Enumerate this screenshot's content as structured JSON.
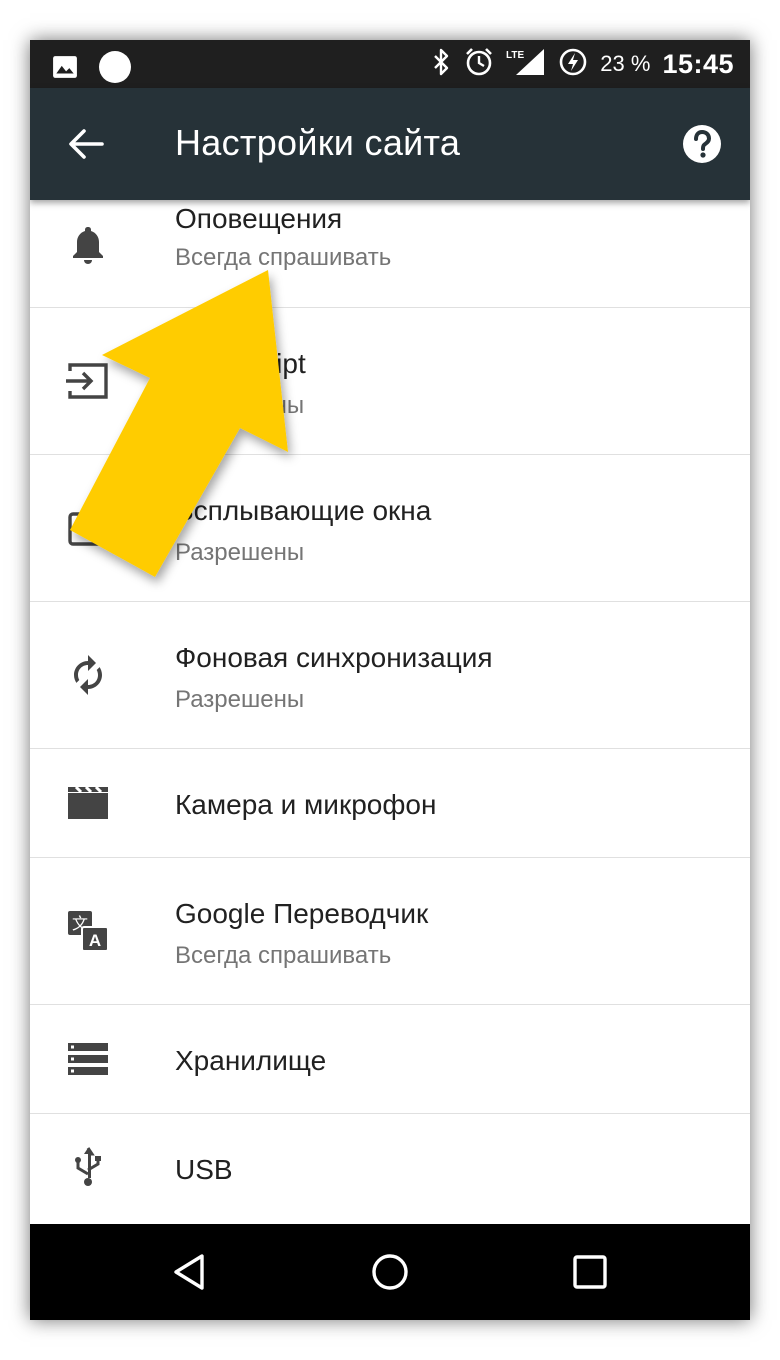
{
  "status_bar": {
    "battery": "23 %",
    "time": "15:45",
    "network": "LTE"
  },
  "app_bar": {
    "title": "Настройки сайта"
  },
  "settings": [
    {
      "title": "Оповещения",
      "subtitle": "Всегда спрашивать",
      "icon": "bell-icon"
    },
    {
      "title": "JavaScript",
      "subtitle": "Разрешены",
      "icon": "input-icon"
    },
    {
      "title": "Всплывающие окна",
      "subtitle": "Разрешены",
      "icon": "popup-window-icon"
    },
    {
      "title": "Фоновая синхронизация",
      "subtitle": "Разрешены",
      "icon": "sync-icon"
    },
    {
      "title": "Камера и микрофон",
      "subtitle": "",
      "icon": "clapperboard-icon"
    },
    {
      "title": "Google Переводчик",
      "subtitle": "Всегда спрашивать",
      "icon": "translate-icon"
    },
    {
      "title": "Хранилище",
      "subtitle": "",
      "icon": "storage-icon"
    },
    {
      "title": "USB",
      "subtitle": "",
      "icon": "usb-icon"
    }
  ],
  "colors": {
    "status_bar": "#1f1f1f",
    "app_bar": "#263238",
    "nav_bar": "#000000",
    "annotation_arrow": "#ffcc00"
  }
}
